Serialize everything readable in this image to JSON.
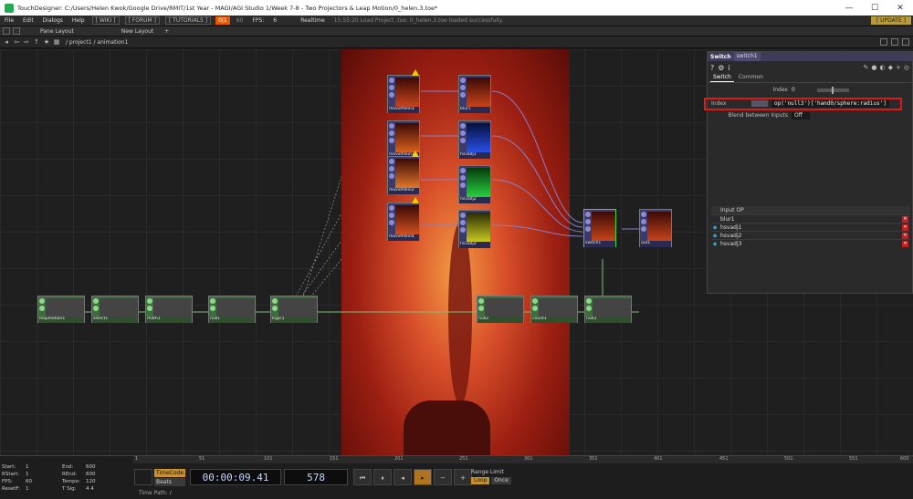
{
  "titlebar": {
    "title": "TouchDesigner: C:/Users/Helen Kwok/Google Drive/RMIT/1st Year - MAGI/AGI Studio 1/Week 7-8 - Two Projectors & Leap Motion/0_helen.3.toe*",
    "minimize": "—",
    "maximize": "☐",
    "close": "✕"
  },
  "menubar": {
    "items": [
      "File",
      "Edit",
      "Dialogs",
      "Help"
    ],
    "wiki": "[ WIKI ]",
    "forum": "[ FORUM ]",
    "tutorials": "[ TUTORIALS ]",
    "perf_badge": "0|1",
    "perf_num": "60",
    "fps_label": "FPS:",
    "fps_value": "6",
    "realtime": "Realtime",
    "status": "15:55:20 Load Project .toe: 0_helen.3.toe loaded successfully.",
    "update": "[ UPDATE ]"
  },
  "panebar": {
    "pane_layout": "Pane Layout",
    "new_layout": "New Layout",
    "plus": "+"
  },
  "pathbar": {
    "path": "/ project1 / animation1"
  },
  "nodes": {
    "top": [
      "moviefilein3",
      "moviefilein1",
      "moviefilein2",
      "moviefilein4"
    ],
    "mid": [
      "blur1",
      "hsvadj1",
      "hsvadj2",
      "hsvadj3"
    ],
    "switch": "switch1",
    "out": "out1",
    "chops": [
      "leapmotion1",
      "select1",
      "math1",
      "null1",
      "logic1",
      "null2",
      "count1",
      "null3"
    ]
  },
  "params": {
    "type": "Switch",
    "name": "switch1",
    "tabs": [
      "Switch",
      "Common"
    ],
    "index_label": "Index",
    "index_value": "0",
    "index_expr_label": "Index",
    "index_expr": "op('null3')['hand0/sphere:radius']",
    "blend_label": "Blend between Inputs",
    "blend_value": "Off",
    "input_op_header": "Input OP",
    "inputs": [
      "blur1",
      "hsvadj1",
      "hsvadj2",
      "hsvadj3"
    ],
    "toolbar_left": [
      "?",
      "⚙",
      "i"
    ],
    "toolbar_right": [
      "✎",
      "●",
      "◐",
      "◆",
      "+",
      "◎"
    ]
  },
  "timeline": {
    "ruler": [
      "1",
      "51",
      "101",
      "151",
      "201",
      "251",
      "301",
      "351",
      "401",
      "451",
      "501",
      "551",
      "600"
    ],
    "stats": [
      {
        "k": "Start:",
        "v": "1",
        "k2": "End:",
        "v2": "600"
      },
      {
        "k": "RStart:",
        "v": "1",
        "k2": "REnd:",
        "v2": "600"
      },
      {
        "k": "FPS:",
        "v": "60",
        "k2": "Tempo:",
        "v2": "120"
      },
      {
        "k": "ResetF:",
        "v": "1",
        "k2": "T Sig:",
        "v2": "4    4"
      }
    ],
    "timecode_label": "TimeCode",
    "beats_label": "Beats",
    "timecode": "00:00:09.41",
    "frame": "578",
    "buttons": [
      "⏮",
      "⏸",
      "◂",
      "▸",
      "−",
      "+"
    ],
    "range_limit": "Range Limit",
    "loop": "Loop",
    "once": "Once",
    "time_path": "Time Path: /"
  }
}
